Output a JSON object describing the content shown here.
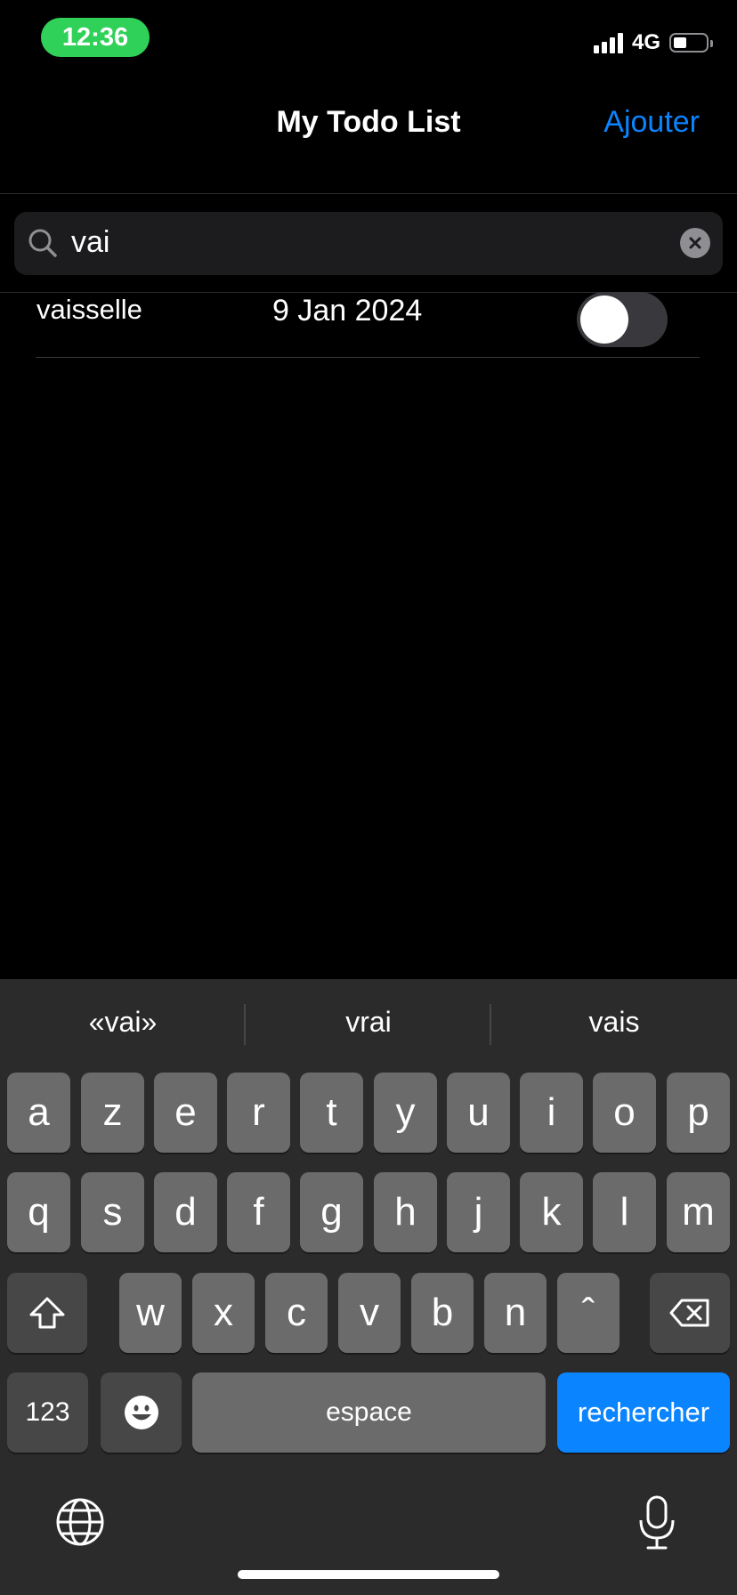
{
  "status": {
    "time": "12:36",
    "network": "4G"
  },
  "nav": {
    "title": "My Todo List",
    "action": "Ajouter"
  },
  "search": {
    "value": "vai"
  },
  "todos": [
    {
      "title": "vaisselle",
      "date": "9 Jan 2024",
      "done": false
    }
  ],
  "keyboard": {
    "suggestions": [
      "«vai»",
      "vrai",
      "vais"
    ],
    "row1": [
      "a",
      "z",
      "e",
      "r",
      "t",
      "y",
      "u",
      "i",
      "o",
      "p"
    ],
    "row2": [
      "q",
      "s",
      "d",
      "f",
      "g",
      "h",
      "j",
      "k",
      "l",
      "m"
    ],
    "row3": [
      "w",
      "x",
      "c",
      "v",
      "b",
      "n",
      "ˆ"
    ],
    "numbers": "123",
    "space": "espace",
    "return": "rechercher"
  },
  "colors": {
    "accent": "#0a84ff",
    "time_pill": "#30d158"
  },
  "icons": [
    "search-icon",
    "clear-icon",
    "shift-icon",
    "delete-icon",
    "emoji-icon",
    "globe-icon",
    "microphone-icon"
  ]
}
